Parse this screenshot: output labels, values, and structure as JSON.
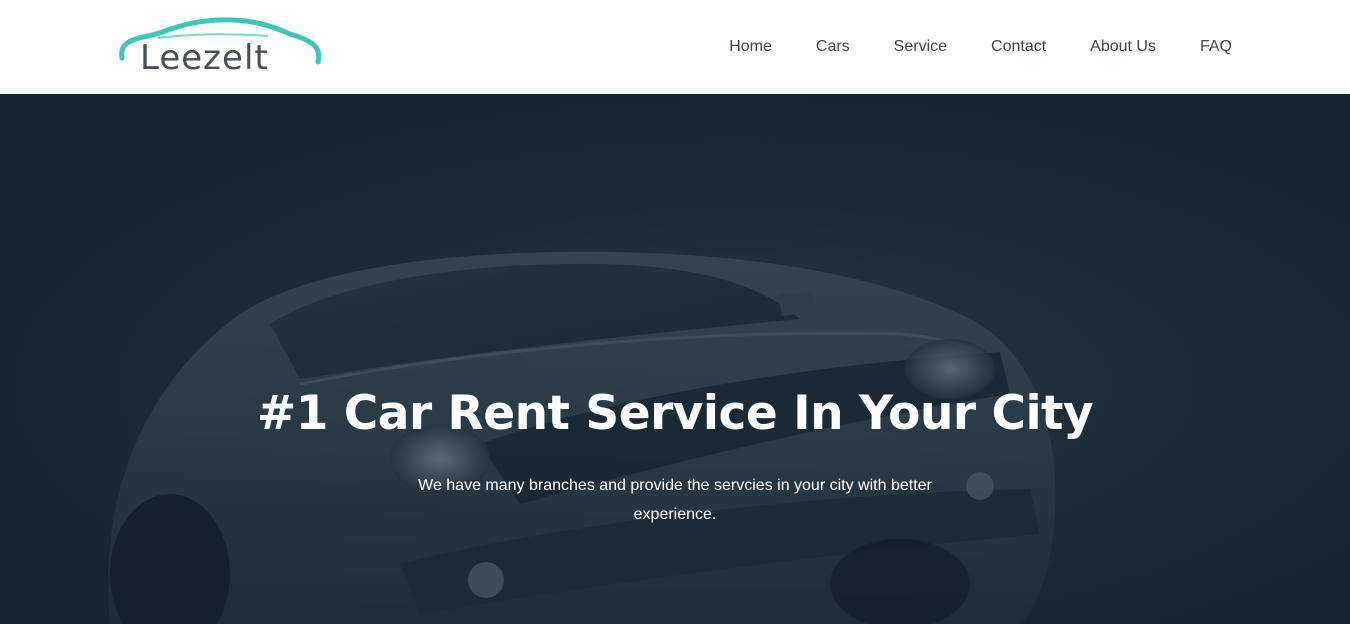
{
  "brand": {
    "name": "Leezelt",
    "accent_color": "#3ec7b9",
    "text_color": "#4a4e55"
  },
  "nav": {
    "items": [
      {
        "label": "Home"
      },
      {
        "label": "Cars"
      },
      {
        "label": "Service"
      },
      {
        "label": "Contact"
      },
      {
        "label": "About Us"
      },
      {
        "label": "FAQ"
      }
    ]
  },
  "hero": {
    "title": "#1 Car Rent Service In Your City",
    "subtitle": "We have many branches and provide the servcies in your city with better experience.",
    "overlay_color": "#1d2f3b",
    "image": "sports-car-front-view"
  }
}
